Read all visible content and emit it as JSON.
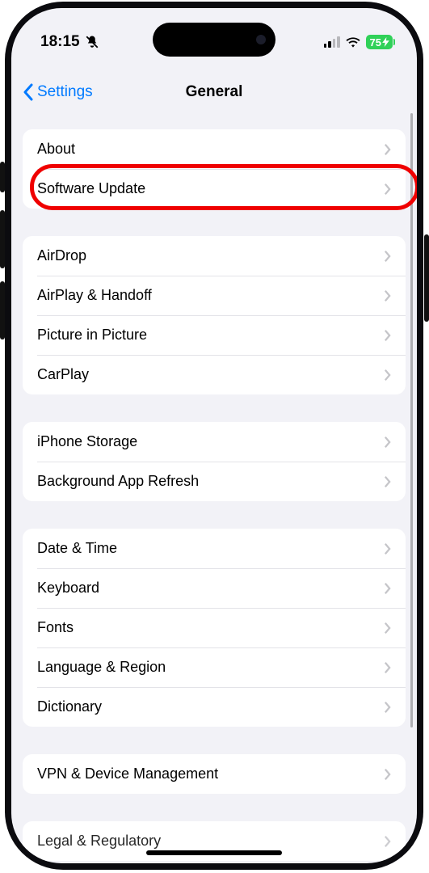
{
  "status": {
    "time": "18:15",
    "battery": "75"
  },
  "nav": {
    "back_label": "Settings",
    "title": "General"
  },
  "groups": [
    {
      "rows": [
        {
          "name": "about",
          "label": "About"
        },
        {
          "name": "software-update",
          "label": "Software Update",
          "highlight": true
        }
      ]
    },
    {
      "rows": [
        {
          "name": "airdrop",
          "label": "AirDrop"
        },
        {
          "name": "airplay-handoff",
          "label": "AirPlay & Handoff"
        },
        {
          "name": "picture-in-picture",
          "label": "Picture in Picture"
        },
        {
          "name": "carplay",
          "label": "CarPlay"
        }
      ]
    },
    {
      "rows": [
        {
          "name": "iphone-storage",
          "label": "iPhone Storage"
        },
        {
          "name": "background-app-refresh",
          "label": "Background App Refresh"
        }
      ]
    },
    {
      "rows": [
        {
          "name": "date-time",
          "label": "Date & Time"
        },
        {
          "name": "keyboard",
          "label": "Keyboard"
        },
        {
          "name": "fonts",
          "label": "Fonts"
        },
        {
          "name": "language-region",
          "label": "Language & Region"
        },
        {
          "name": "dictionary",
          "label": "Dictionary"
        }
      ]
    },
    {
      "rows": [
        {
          "name": "vpn-device-management",
          "label": "VPN & Device Management"
        }
      ]
    },
    {
      "rows": [
        {
          "name": "legal-regulatory",
          "label": "Legal & Regulatory",
          "cutoff": true
        }
      ]
    }
  ]
}
